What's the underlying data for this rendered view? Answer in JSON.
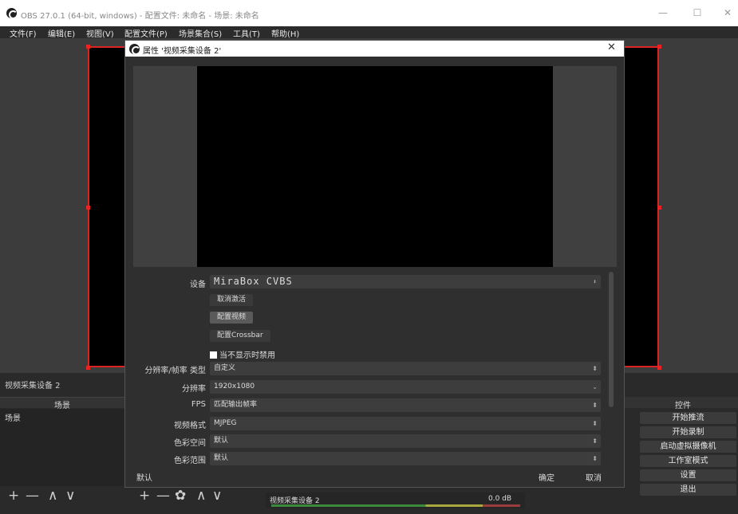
{
  "window": {
    "title": "OBS 27.0.1 (64-bit, windows) - 配置文件: 未命名 - 场景: 未命名"
  },
  "window_controls": {
    "minimize": "—",
    "maximize": "☐",
    "close": "✕"
  },
  "menu": [
    "文件(F)",
    "编辑(E)",
    "视图(V)",
    "配置文件(P)",
    "场景集合(S)",
    "工具(T)",
    "帮助(H)"
  ],
  "sources_bar": {
    "selected_source": "视频采集设备 2"
  },
  "scenes": {
    "title": "场景",
    "items": [
      "场景"
    ]
  },
  "scene_toolbar": {
    "add": "+",
    "remove": "—",
    "up": "∧",
    "down": "∨"
  },
  "source_toolbar": {
    "add": "+",
    "remove": "—",
    "settings": "✿",
    "up": "∧",
    "down": "∨"
  },
  "controls": {
    "title": "控件",
    "buttons": [
      "开始推流",
      "开始录制",
      "启动虚拟摄像机",
      "工作室模式",
      "设置",
      "退出"
    ]
  },
  "mixer": {
    "source_name": "视频采集设备 2",
    "level": "0.0 dB"
  },
  "dialog": {
    "title": "属性 '视频采集设备 2'",
    "close": "✕",
    "device_label": "设备",
    "device_value": "MiraBox CVBS",
    "deactivate_button": "取消激活",
    "config_video_button": "配置视频",
    "config_crossbar_button": "配置Crossbar",
    "hide_disable_checkbox": "当不显示时禁用",
    "fields": [
      {
        "label": "分辨率/帧率 类型",
        "value": "自定义",
        "arrow": "⬍"
      },
      {
        "label": "分辨率",
        "value": "1920x1080",
        "arrow": "⌄"
      },
      {
        "label": "FPS",
        "value": "匹配输出帧率",
        "arrow": "⬍"
      },
      {
        "label": "视频格式",
        "value": "MJPEG",
        "arrow": "⬍"
      },
      {
        "label": "色彩空间",
        "value": "默认",
        "arrow": "⬍"
      },
      {
        "label": "色彩范围",
        "value": "默认",
        "arrow": "⬍"
      }
    ],
    "defaults_button": "默认",
    "ok_button": "确定",
    "cancel_button": "取消"
  },
  "colors": {
    "accent_red": "#dd2222",
    "panel_bg": "#2a2a2a"
  }
}
